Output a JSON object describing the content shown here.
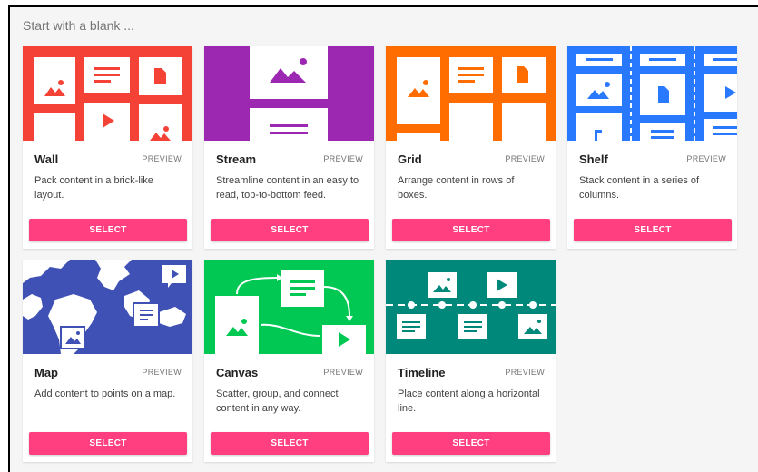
{
  "heading": "Start with a blank ...",
  "preview_label": "PREVIEW",
  "select_label": "SELECT",
  "layouts": [
    {
      "name": "Wall",
      "description": "Pack content in a brick-like layout.",
      "color": "#f44336",
      "icon": "wall-layout-icon"
    },
    {
      "name": "Stream",
      "description": "Streamline content in an easy to read, top-to-bottom feed.",
      "color": "#9c27b0",
      "icon": "stream-layout-icon"
    },
    {
      "name": "Grid",
      "description": "Arrange content in rows of boxes.",
      "color": "#ff6d00",
      "icon": "grid-layout-icon"
    },
    {
      "name": "Shelf",
      "description": "Stack content in a series of columns.",
      "color": "#2979ff",
      "icon": "shelf-layout-icon"
    },
    {
      "name": "Map",
      "description": "Add content to points on a map.",
      "color": "#3f51b5",
      "icon": "map-layout-icon"
    },
    {
      "name": "Canvas",
      "description": "Scatter, group, and connect content in any way.",
      "color": "#00c853",
      "icon": "canvas-layout-icon"
    },
    {
      "name": "Timeline",
      "description": "Place content along a horizontal line.",
      "color": "#00897b",
      "icon": "timeline-layout-icon"
    }
  ]
}
